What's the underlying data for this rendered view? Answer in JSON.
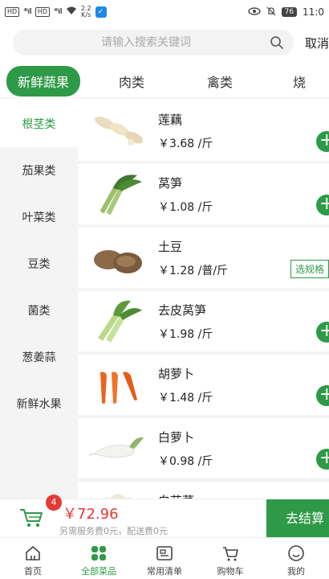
{
  "status_bar": {
    "sim1": "HD",
    "sim2": "HD",
    "signal1": "⁴⁶ıll",
    "signal2": "⁴⁶ıll",
    "speed": "2.2\nK/s",
    "battery": "76",
    "time": "11:0"
  },
  "search": {
    "placeholder": "请输入搜索关键词",
    "cancel_label": "取消"
  },
  "tabs": [
    {
      "label": "新鲜蔬果",
      "active": true
    },
    {
      "label": "肉类"
    },
    {
      "label": "禽类"
    },
    {
      "label": "烧"
    }
  ],
  "sidebar": {
    "items": [
      {
        "label": "根茎类",
        "active": true
      },
      {
        "label": "茄果类"
      },
      {
        "label": "叶菜类"
      },
      {
        "label": "豆类"
      },
      {
        "label": "菌类"
      },
      {
        "label": "葱姜蒜"
      },
      {
        "label": "新鲜水果"
      }
    ]
  },
  "products": [
    {
      "name": "莲藕",
      "price": "￥3.68 /斤",
      "action": "add",
      "icon": "lotus-root-image"
    },
    {
      "name": "莴笋",
      "price": "￥1.08 /斤",
      "action": "add",
      "icon": "lettuce-stem-image"
    },
    {
      "name": "土豆",
      "price": "￥1.28 /普/斤",
      "action": "spec",
      "spec_label": "选规格",
      "icon": "potato-image"
    },
    {
      "name": "去皮莴笋",
      "price": "￥1.98 /斤",
      "action": "add",
      "icon": "peeled-lettuce-stem-image"
    },
    {
      "name": "胡萝卜",
      "price": "￥1.48 /斤",
      "action": "add",
      "icon": "carrot-image"
    },
    {
      "name": "白萝卜",
      "price": "￥0.98 /斤",
      "action": "add",
      "icon": "radish-image"
    },
    {
      "name": "白花菜",
      "price": "",
      "action": "none",
      "icon": "cauliflower-image"
    }
  ],
  "add_symbol": "+",
  "cart": {
    "badge_count": "4",
    "total": "￥72.96",
    "fee_note": "另需服务费0元，配送费0元",
    "checkout_label": "去结算"
  },
  "bottom_nav": [
    {
      "label": "首页",
      "icon": "home-icon"
    },
    {
      "label": "全部菜品",
      "icon": "grid-icon",
      "active": true
    },
    {
      "label": "常用清单",
      "icon": "list-icon"
    },
    {
      "label": "购物车",
      "icon": "cart-icon"
    },
    {
      "label": "我的",
      "icon": "profile-icon"
    }
  ],
  "colors": {
    "accent": "#2e9a47",
    "price_red": "#e53935"
  }
}
